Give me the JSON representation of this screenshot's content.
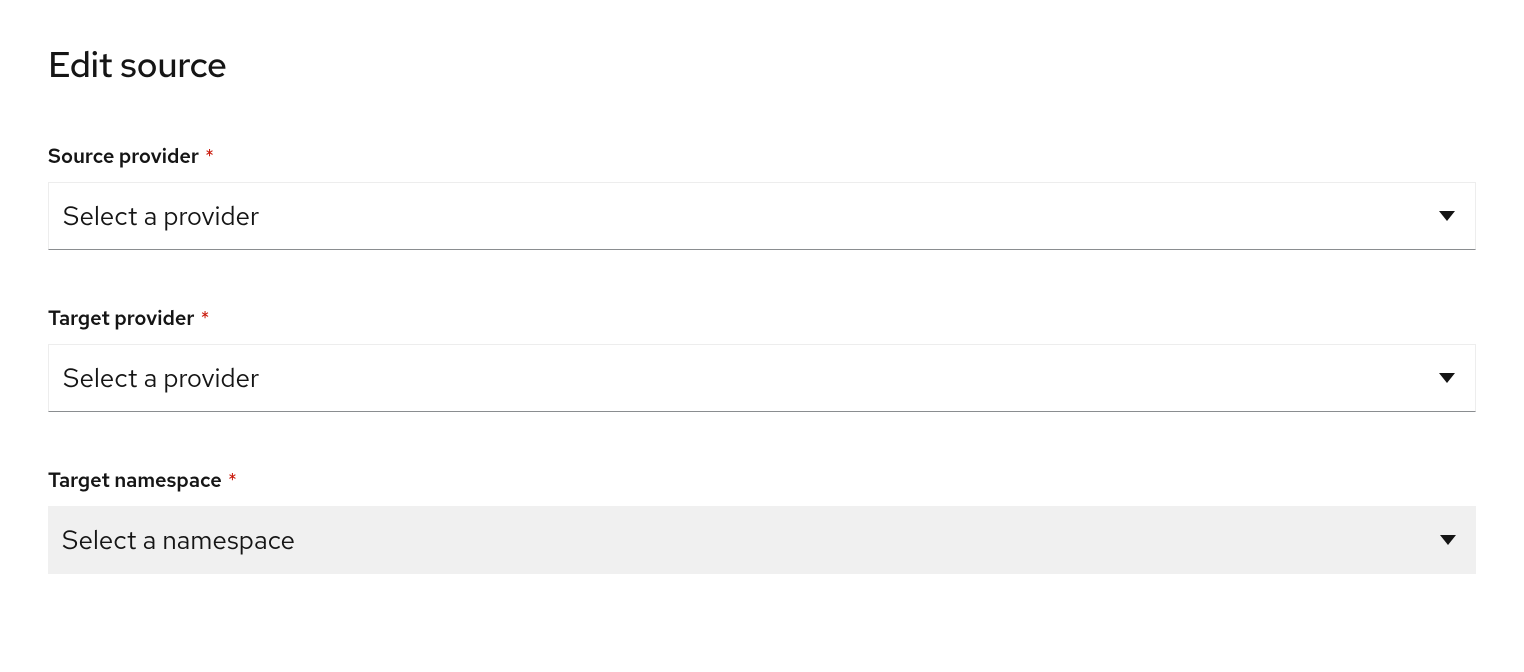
{
  "page": {
    "title": "Edit source"
  },
  "form": {
    "source_provider": {
      "label": "Source provider",
      "required": true,
      "placeholder": "Select a provider"
    },
    "target_provider": {
      "label": "Target provider",
      "required": true,
      "placeholder": "Select a provider"
    },
    "target_namespace": {
      "label": "Target namespace",
      "required": true,
      "placeholder": "Select a namespace",
      "disabled": true
    }
  }
}
